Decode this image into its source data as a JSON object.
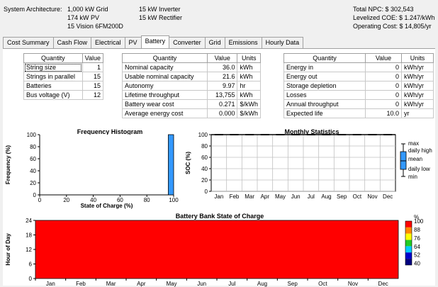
{
  "header": {
    "arch_label": "System Architecture:",
    "arch_col1": [
      "1,000 kW Grid",
      "174 kW PV",
      "15 Vision 6FM200D"
    ],
    "arch_col2": [
      "15 kW Inverter",
      "15 kW Rectifier"
    ],
    "npc": "Total NPC: $ 302,543",
    "coe": "Levelized COE: $ 1.247/kWh",
    "opcost": "Operating Cost: $ 14,805/yr"
  },
  "tabs": [
    "Cost Summary",
    "Cash Flow",
    "Electrical",
    "PV",
    "Battery",
    "Converter",
    "Grid",
    "Emissions",
    "Hourly Data"
  ],
  "active_tab": "Battery",
  "table1": {
    "headers": [
      "Quantity",
      "Value"
    ],
    "rows": [
      [
        "String size",
        "1"
      ],
      [
        "Strings in parallel",
        "15"
      ],
      [
        "Batteries",
        "15"
      ],
      [
        "Bus voltage (V)",
        "12"
      ]
    ]
  },
  "table2": {
    "headers": [
      "Quantity",
      "Value",
      "Units"
    ],
    "rows": [
      [
        "Nominal capacity",
        "36.0",
        "kWh"
      ],
      [
        "Usable nominal capacity",
        "21.6",
        "kWh"
      ],
      [
        "Autonomy",
        "9.97",
        "hr"
      ],
      [
        "Lifetime throughput",
        "13,755",
        "kWh"
      ],
      [
        "Battery wear cost",
        "0.271",
        "$/kWh"
      ],
      [
        "Average energy cost",
        "0.000",
        "$/kWh"
      ]
    ]
  },
  "table3": {
    "headers": [
      "Quantity",
      "Value",
      "Units"
    ],
    "rows": [
      [
        "Energy in",
        "0",
        "kWh/yr"
      ],
      [
        "Energy out",
        "0",
        "kWh/yr"
      ],
      [
        "Storage depletion",
        "0",
        "kWh/yr"
      ],
      [
        "Losses",
        "0",
        "kWh/yr"
      ],
      [
        "Annual throughput",
        "0",
        "kWh/yr"
      ],
      [
        "Expected life",
        "10.0",
        "yr"
      ]
    ]
  },
  "chart_data": [
    {
      "type": "bar",
      "title": "Frequency Histogram",
      "xlabel": "State of Charge (%)",
      "ylabel": "Frequency (%)",
      "xlim": [
        0,
        100
      ],
      "ylim": [
        0,
        100
      ],
      "xticks": [
        "0",
        "20",
        "40",
        "60",
        "80",
        "100"
      ],
      "yticks": [
        "0",
        "20",
        "40",
        "60",
        "80",
        "100"
      ],
      "bins": [
        {
          "x0": 96,
          "x1": 100,
          "value": 100
        }
      ],
      "bar_color": "#3399ff"
    },
    {
      "type": "box",
      "title": "Monthly Statistics",
      "ylabel": "SOC (%)",
      "ylim": [
        0,
        100
      ],
      "yticks": [
        "0",
        "20",
        "40",
        "60",
        "80",
        "100"
      ],
      "categories": [
        "Jan",
        "Feb",
        "Mar",
        "Apr",
        "May",
        "Jun",
        "Jul",
        "Aug",
        "Sep",
        "Oct",
        "Nov",
        "Dec"
      ],
      "max": [
        100,
        100,
        100,
        100,
        100,
        100,
        100,
        100,
        100,
        100,
        100,
        100
      ],
      "daily_high": [
        100,
        100,
        100,
        100,
        100,
        100,
        100,
        100,
        100,
        100,
        100,
        100
      ],
      "mean": [
        100,
        100,
        100,
        100,
        100,
        100,
        100,
        100,
        100,
        100,
        100,
        100
      ],
      "daily_low": [
        100,
        100,
        100,
        100,
        100,
        100,
        100,
        100,
        100,
        100,
        100,
        100
      ],
      "min": [
        100,
        100,
        100,
        100,
        100,
        100,
        100,
        100,
        100,
        100,
        100,
        100
      ],
      "legend": [
        "max",
        "daily high",
        "mean",
        "daily low",
        "min"
      ]
    },
    {
      "type": "heatmap",
      "title": "Battery Bank State of Charge",
      "ylabel": "Hour of Day",
      "ylim": [
        0,
        24
      ],
      "yticks": [
        "0",
        "6",
        "12",
        "18",
        "24"
      ],
      "xticks": [
        "Jan",
        "Feb",
        "Mar",
        "Apr",
        "May",
        "Jun",
        "Jul",
        "Aug",
        "Sep",
        "Oct",
        "Nov",
        "Dec"
      ],
      "value": 100,
      "fill_color": "#ff0000",
      "colorbar": {
        "unit": "%",
        "labels": [
          "100",
          "88",
          "76",
          "64",
          "52",
          "40"
        ],
        "colors": [
          "#ff0000",
          "#ff8800",
          "#ffff00",
          "#22cc22",
          "#00ccff",
          "#0000cc",
          "#000080"
        ]
      }
    }
  ]
}
